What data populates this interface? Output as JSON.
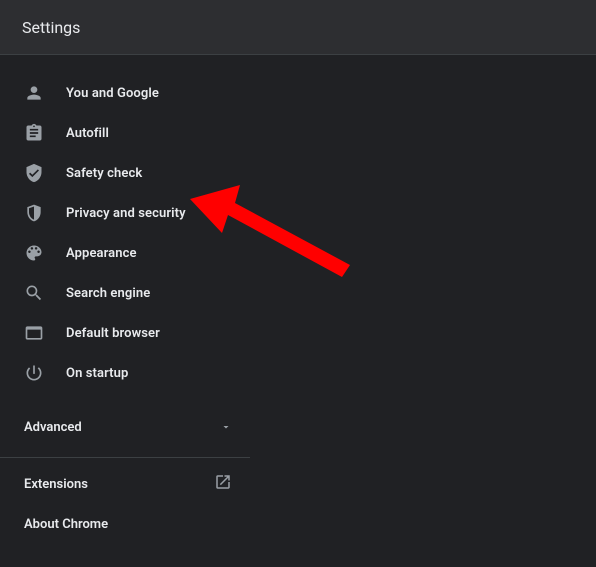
{
  "header": {
    "title": "Settings"
  },
  "sidebar": {
    "items": [
      {
        "label": "You and Google"
      },
      {
        "label": "Autofill"
      },
      {
        "label": "Safety check"
      },
      {
        "label": "Privacy and security"
      },
      {
        "label": "Appearance"
      },
      {
        "label": "Search engine"
      },
      {
        "label": "Default browser"
      },
      {
        "label": "On startup"
      }
    ],
    "advanced_label": "Advanced",
    "footer": {
      "extensions_label": "Extensions",
      "about_label": "About Chrome"
    }
  }
}
